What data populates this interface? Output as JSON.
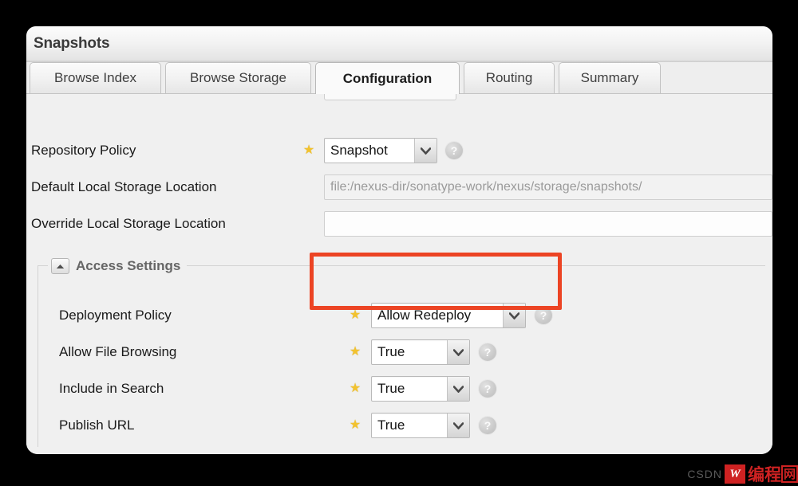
{
  "window": {
    "title": "Snapshots"
  },
  "tabs": [
    {
      "label": "Browse Index",
      "active": false
    },
    {
      "label": "Browse Storage",
      "active": false
    },
    {
      "label": "Configuration",
      "active": true
    },
    {
      "label": "Routing",
      "active": false
    },
    {
      "label": "Summary",
      "active": false
    }
  ],
  "form": {
    "rows": [
      {
        "label": "Repository Policy",
        "control": "select",
        "value": "Snapshot",
        "required": true,
        "help": "?"
      },
      {
        "label": "Default Local Storage Location",
        "control": "text-readonly",
        "value": "file:/nexus-dir/sonatype-work/nexus/storage/snapshots/",
        "required": false,
        "help": ""
      },
      {
        "label": "Override Local Storage Location",
        "control": "text",
        "value": "",
        "required": false,
        "help": ""
      }
    ]
  },
  "access_settings": {
    "legend": "Access Settings",
    "collapse_icon": "chevron-up-icon",
    "rows": [
      {
        "label": "Deployment Policy",
        "control": "select",
        "value": "Allow Redeploy",
        "required": true,
        "help": "?",
        "highlighted": true
      },
      {
        "label": "Allow File Browsing",
        "control": "select",
        "value": "True",
        "required": true,
        "help": "?",
        "highlighted": false
      },
      {
        "label": "Include in Search",
        "control": "select",
        "value": "True",
        "required": true,
        "help": "?",
        "highlighted": false
      },
      {
        "label": "Publish URL",
        "control": "select",
        "value": "True",
        "required": true,
        "help": "?",
        "highlighted": false
      }
    ]
  },
  "annotation": {
    "highlight_color": "#ec4424"
  },
  "watermark": {
    "site": "CSDN",
    "badge": "W",
    "brand_1": "编程",
    "brand_2": "网"
  },
  "colors": {
    "accent": "#ec4424",
    "star": "#f2c22e",
    "panel_bg": "#f0f0f0",
    "backdrop": "#000000"
  }
}
